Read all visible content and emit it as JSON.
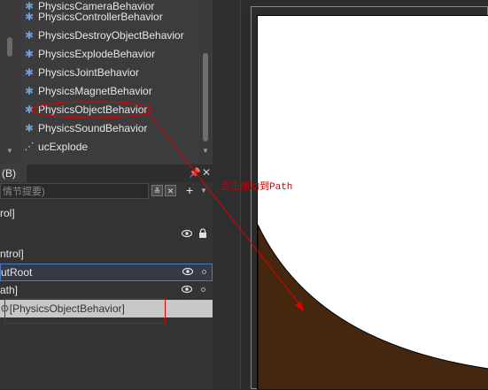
{
  "behaviors": {
    "items": [
      {
        "label": "PhysicsCameraBehavior",
        "icon": "gear-icon"
      },
      {
        "label": "PhysicsControllerBehavior",
        "icon": "gear-icon"
      },
      {
        "label": "PhysicsDestroyObjectBehavior",
        "icon": "gear-icon"
      },
      {
        "label": "PhysicsExplodeBehavior",
        "icon": "gear-icon"
      },
      {
        "label": "PhysicsJointBehavior",
        "icon": "gear-icon"
      },
      {
        "label": "PhysicsMagnetBehavior",
        "icon": "gear-icon"
      },
      {
        "label": "PhysicsObjectBehavior",
        "icon": "gear-icon"
      },
      {
        "label": "PhysicsSoundBehavior",
        "icon": "gear-icon"
      },
      {
        "label": "ucExplode",
        "icon": "user-control-icon"
      }
    ]
  },
  "objects_panel": {
    "tab_label": "(B)",
    "search_placeholder": "情节提要)",
    "tree": [
      {
        "label": "rol]"
      },
      {
        "label": ""
      },
      {
        "label": "ntrol]"
      },
      {
        "label": "utRoot"
      },
      {
        "label": "ath]"
      },
      {
        "label": "[PhysicsObjectBehavior]"
      }
    ]
  },
  "annotation": {
    "text": "点击拖动到Path",
    "color": "#cc0000"
  },
  "colors": {
    "panel_bg": "#333333",
    "selection_bg": "#c8c8c8",
    "layout_root_border": "#4e7bc6",
    "gear_icon": "#6f9fd8",
    "shape_fill": "#45270f"
  }
}
